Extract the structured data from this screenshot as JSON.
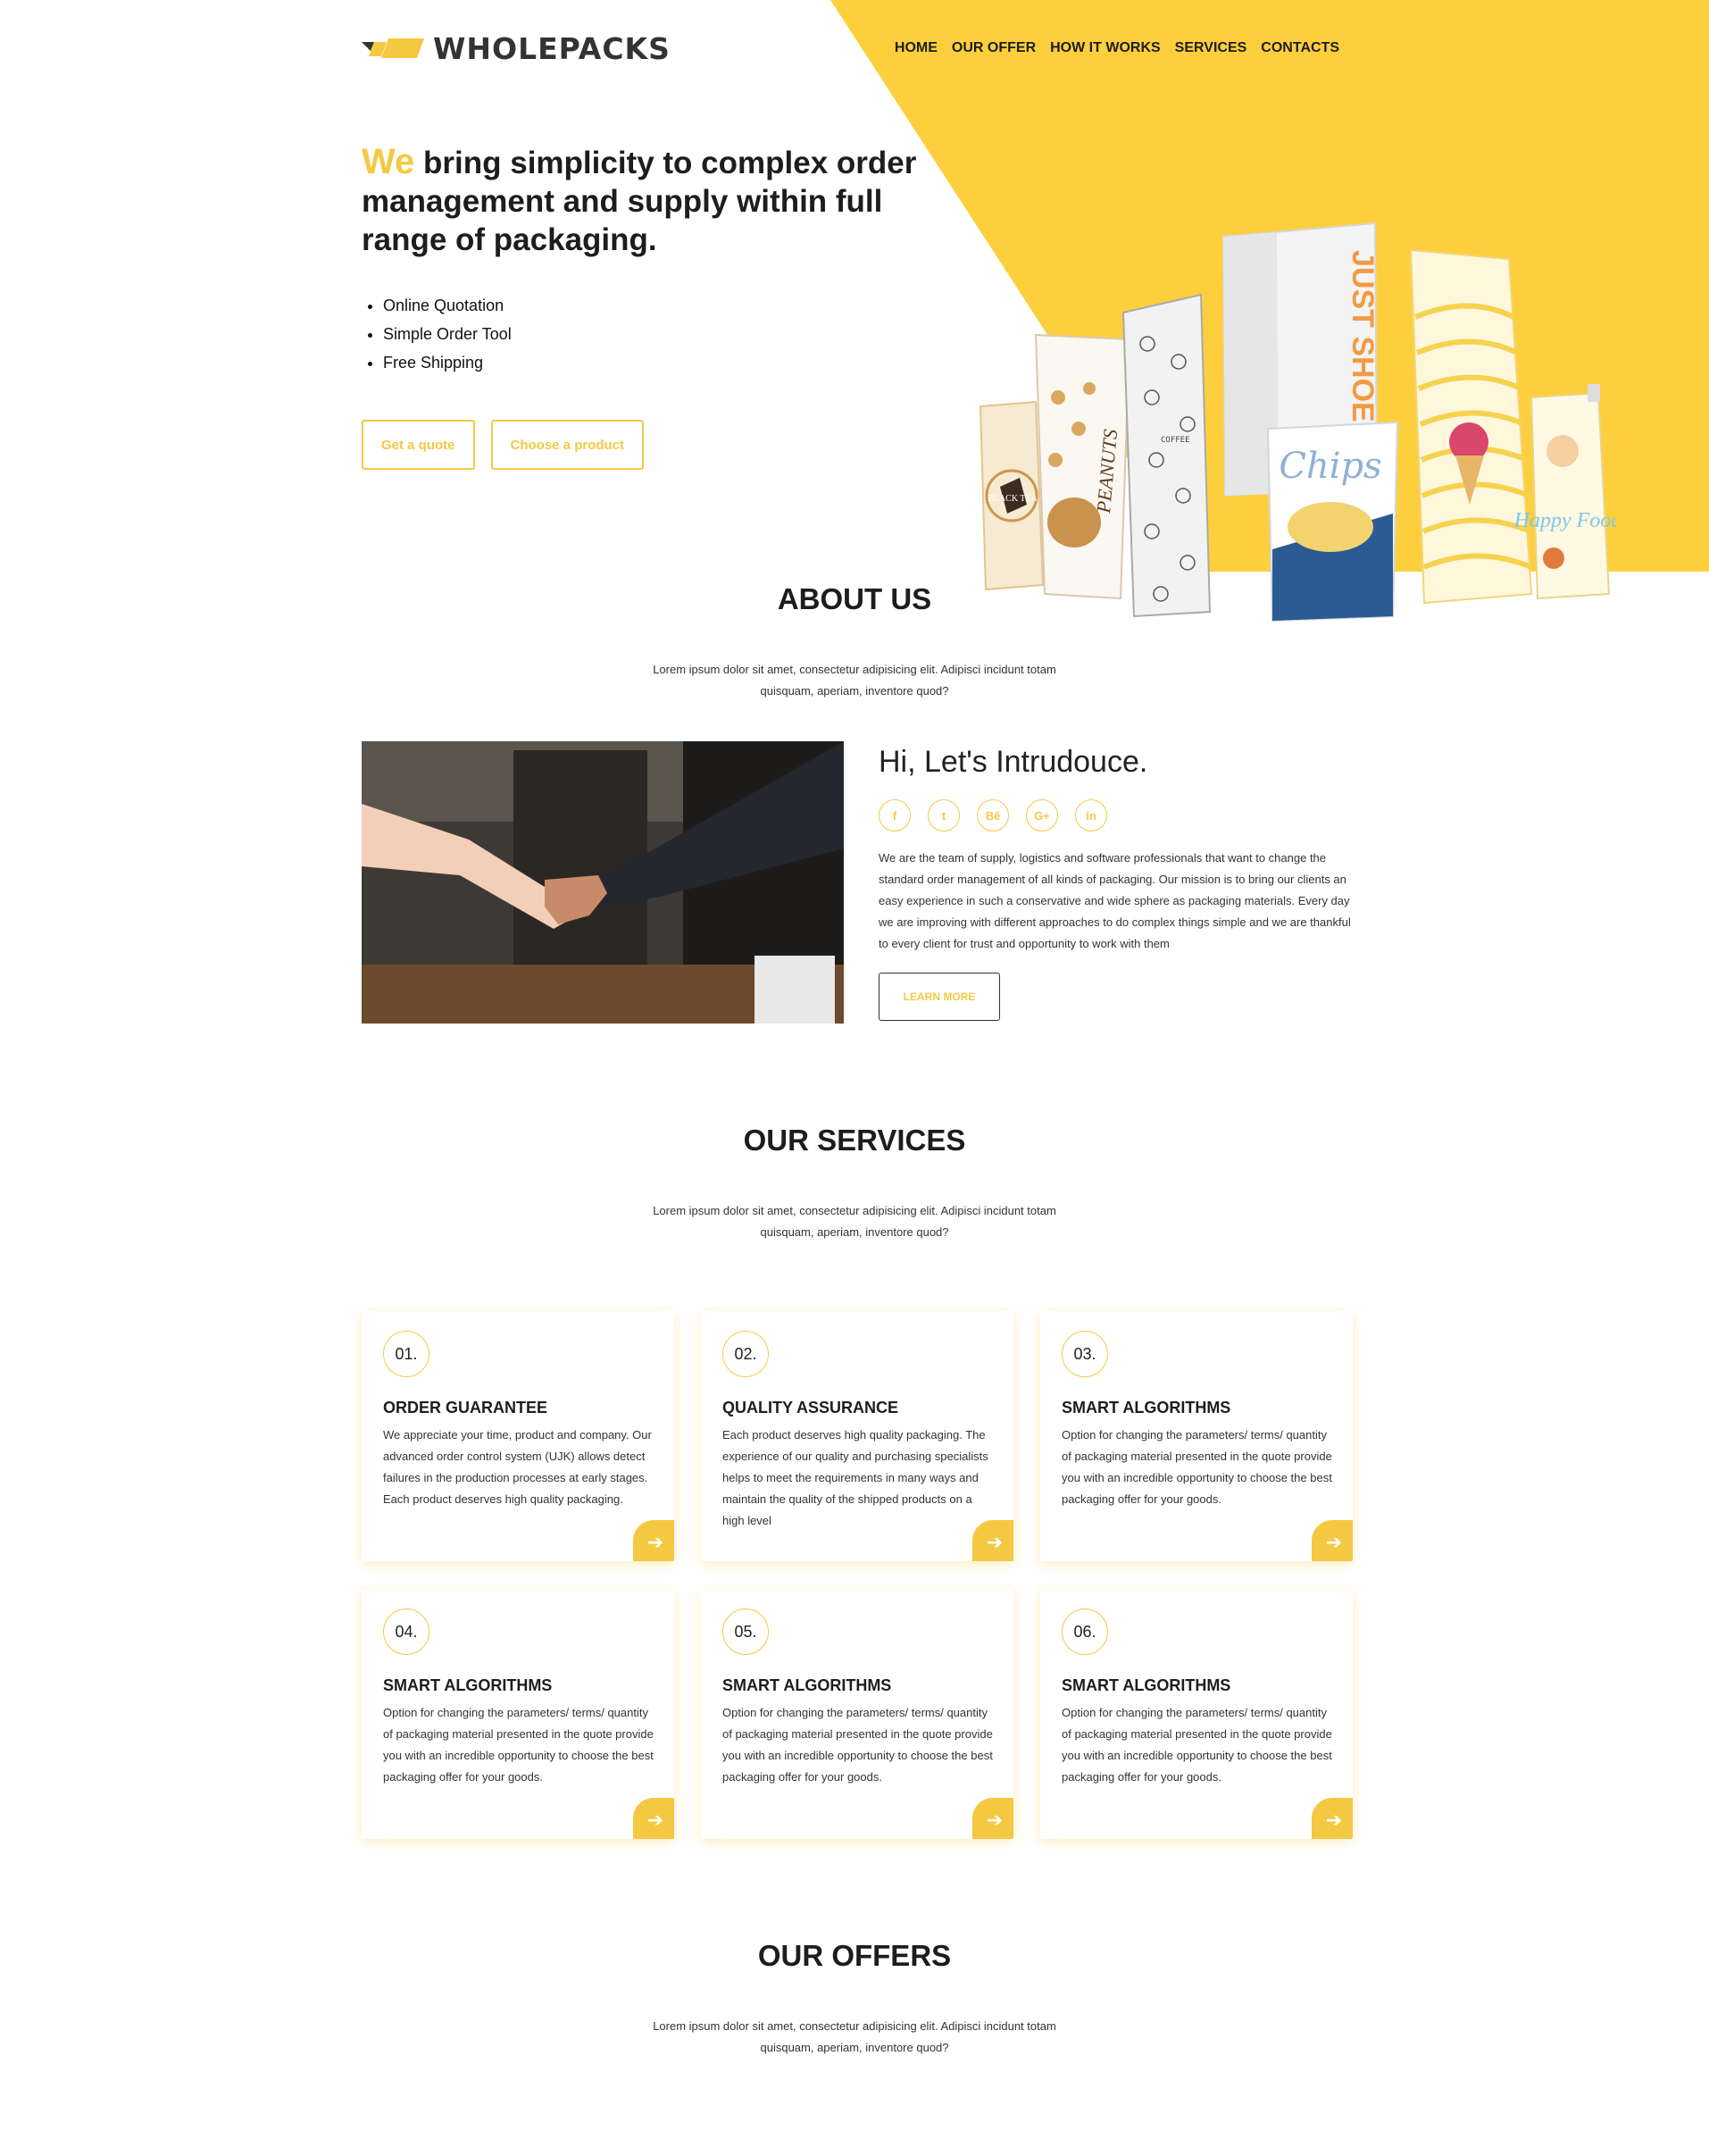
{
  "brand": {
    "name": "WHOLEPACKS",
    "accent_color": "#f5c842",
    "logo_icon": "logo-stripes-icon"
  },
  "nav": {
    "items": [
      "HOME",
      "OUR OFFER",
      "HOW IT WORKS",
      "SERVICES",
      "CONTACTS"
    ]
  },
  "hero": {
    "accent_word": "We",
    "headline": "bring simplicity to complex order management and supply within full range of packaging.",
    "features": [
      "Online Quotation",
      "Simple Order Tool",
      "Free Shipping"
    ],
    "buttons": {
      "quote": "Get a quote",
      "product": "Choose a product"
    },
    "product_labels": {
      "tea": "BLACK TEA",
      "peanuts": "PEANUTS",
      "coffee": "COFFEE",
      "box": "JUST SHOE",
      "chips": "Chips",
      "pouch": "Happy Food"
    }
  },
  "about": {
    "title": "ABOUT US",
    "subtitle": "Lorem ipsum dolor sit amet, consectetur adipisicing elit. Adipisci incidunt totam quisquam, aperiam, inventore quod?",
    "intro_title": "Hi, Let's Intrudouce.",
    "socials": [
      {
        "label": "f",
        "icon": "facebook-icon"
      },
      {
        "label": "t",
        "icon": "twitter-icon"
      },
      {
        "label": "Bē",
        "icon": "behance-icon"
      },
      {
        "label": "G+",
        "icon": "google-plus-icon"
      },
      {
        "label": "in",
        "icon": "linkedin-icon"
      }
    ],
    "body": "We are the team of supply, logistics and software professionals that want to change the standard order management of all kinds of packaging. Our mission is to bring our clients an easy experience in such a conservative and wide sphere as packaging materials. Every day we are improving with different approaches to do complex things simple and we are thankful to every client for trust and opportunity to work with them",
    "button": "LEARN MORE"
  },
  "services": {
    "title": "OUR SERVICES",
    "subtitle": "Lorem ipsum dolor sit amet, consectetur adipisicing elit. Adipisci incidunt totam quisquam, aperiam, inventore quod?",
    "cards": [
      {
        "num": "01.",
        "title": "ORDER GUARANTEE",
        "text": "We appreciate your time, product and company. Our advanced order control system (UJK) allows detect failures in the production processes at early stages. Each product deserves high quality packaging."
      },
      {
        "num": "02.",
        "title": "QUALITY ASSURANCE",
        "text": "Each product deserves high quality packaging. The experience of our quality and purchasing specialists helps to meet the requirements in many ways and maintain the quality of the shipped products on a high level"
      },
      {
        "num": "03.",
        "title": "SMART ALGORITHMS",
        "text": "Option for changing the parameters/ terms/ quantity of packaging material presented in the quote provide you with an incredible opportunity to choose the best packaging offer for your goods."
      },
      {
        "num": "04.",
        "title": "SMART ALGORITHMS",
        "text": "Option for changing the parameters/ terms/ quantity of packaging material presented in the quote provide you with an incredible opportunity to choose the best packaging offer for your goods."
      },
      {
        "num": "05.",
        "title": "SMART ALGORITHMS",
        "text": "Option for changing the parameters/ terms/ quantity of packaging material presented in the quote provide you with an incredible opportunity to choose the best packaging offer for your goods."
      },
      {
        "num": "06.",
        "title": "SMART ALGORITHMS",
        "text": "Option for changing the parameters/ terms/ quantity of packaging material presented in the quote provide you with an incredible opportunity to choose the best packaging offer for your goods."
      }
    ],
    "arrow_glyph": "➔"
  },
  "offers": {
    "title": "OUR OFFERS",
    "subtitle": "Lorem ipsum dolor sit amet, consectetur adipisicing elit. Adipisci incidunt totam quisquam, aperiam, inventore quod?"
  }
}
